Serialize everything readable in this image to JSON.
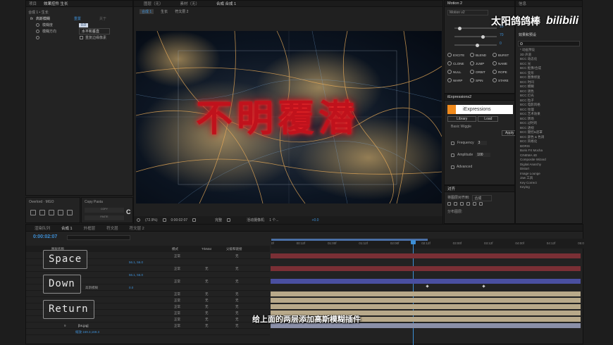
{
  "project_panel": {
    "tabs": [
      "项目",
      "效果控件 生长"
    ],
    "breadcrumb": "合成 1 • 生长",
    "effect_name": "高斯模糊",
    "effect_reset": "重置",
    "effect_about": "关于",
    "props": [
      {
        "label": "模糊度",
        "value": "0.0"
      },
      {
        "label": "模糊方向",
        "value": "水平和垂直"
      },
      {
        "label": "",
        "value": "重复边缘像素"
      }
    ]
  },
  "viewer": {
    "tabs": [
      "图层（无）",
      "素材（无）",
      "合成 合成 1"
    ],
    "breadcrumb": [
      "合成 1",
      "生长",
      "符文层 2"
    ],
    "zoom": "(72.9%)",
    "timecode": "0:00:02:07",
    "quality": "完整",
    "camera": "活动摄像机",
    "views": "1 个...",
    "exposure": "+0.0",
    "title_text": "不明覆潜"
  },
  "motion_panel": {
    "title": "Motion 2",
    "version": "Motion v2",
    "values": [
      "10",
      "70",
      "0"
    ],
    "buttons": [
      "EXCITE",
      "BLEND",
      "BURST",
      "CLONE",
      "JUMP",
      "NAME",
      "NULL",
      "ORBIT",
      "ROPE",
      "WARP",
      "SPIN",
      "STARE"
    ]
  },
  "iexpressions": {
    "tab": "iExpressions2",
    "brand": "iExpressions",
    "buttons": [
      "Library",
      "Load"
    ],
    "apply": "Apply",
    "preset": "Basic Wiggle",
    "params": [
      {
        "label": "Frequency",
        "value": "3"
      },
      {
        "label": "Amplitude",
        "value": "100"
      }
    ],
    "advanced": "Advanced"
  },
  "align_panel": {
    "title": "对齐",
    "align_to_label": "将图层对齐到:",
    "align_to_value": "合成",
    "distribute": "分布图层:"
  },
  "effects_panel": {
    "tabs": [
      "信息",
      "效果和预设"
    ],
    "search": "",
    "items": [
      "* 动画预设",
      "3D 声道",
      "BCC 动态化",
      "BCC 光",
      "BCC 抠像/合成",
      "BCC 变形",
      "BCC 图像修复",
      "BCC 时间",
      "BCC 模糊",
      "BCC 调色",
      "BCC 灯光",
      "BCC 粒子",
      "BCC 电影风格",
      "BCC 纹理",
      "BCC 艺术效果",
      "BCC 转场",
      "BCC 过时的",
      "BCC 透视",
      "BCC 键控&遮罩",
      "BCC 颜色 & 色调",
      "BCC 风格化",
      "BORIS",
      "Boris FX Mocha",
      "CINEMA 4D",
      "Composite Wizard",
      "Digital Anarchy",
      "Distort",
      "Image Lounge",
      "Jaw 工具",
      "Key Correct",
      "Keying"
    ]
  },
  "overlord": {
    "title": "Overlord · MGO"
  },
  "copypasta": {
    "title": "Copy Pasta",
    "buttons": [
      "COPY",
      "PASTE"
    ]
  },
  "timeline": {
    "tabs": [
      "渲染队列",
      "合成 1",
      "外框层",
      "符文层",
      "符文层 2"
    ],
    "timecode": "0:00:02:07",
    "ruler": [
      "0f",
      "00:12f",
      "01:00f",
      "01:12f",
      "02:00f",
      "02:12f",
      "03:00f",
      "03:12f",
      "04:00f",
      "04:12f",
      "05:0"
    ],
    "columns": [
      "图层名称",
      "模式",
      "TrkMat",
      "父级和链接"
    ],
    "mode": "正常",
    "none": "无",
    "layers": [
      {
        "num": "",
        "name": "",
        "sub": "56.1, 56.0"
      },
      {
        "num": "",
        "name": "",
        "sub": "56.1, 56.0"
      },
      {
        "num": "",
        "name": "",
        "sub": ""
      },
      {
        "num": "",
        "name": "高斯模糊",
        "sub": "0.0"
      },
      {
        "num": "",
        "name": "",
        "sub": ""
      },
      {
        "num": "",
        "name": "",
        "sub": ""
      },
      {
        "num": "",
        "name": "",
        "sub": ""
      },
      {
        "num": "",
        "name": "",
        "sub": ""
      },
      {
        "num": "9",
        "name": "[bs.jpg]",
        "sub": "缩放  169.3,169.3"
      }
    ]
  },
  "keycast": [
    "Space",
    "Down",
    "Return"
  ],
  "subtitle": "给上面的两层添加高斯模糊插件",
  "watermark": {
    "channel": "太阳鸽鸽棒",
    "site": "bilibili"
  },
  "colors": {
    "accent": "#3d8fd6",
    "red_title": "#c0121c",
    "track_red": "#7a2f35",
    "track_blue": "#4a4fa0",
    "track_tan": "#b8a98a"
  }
}
